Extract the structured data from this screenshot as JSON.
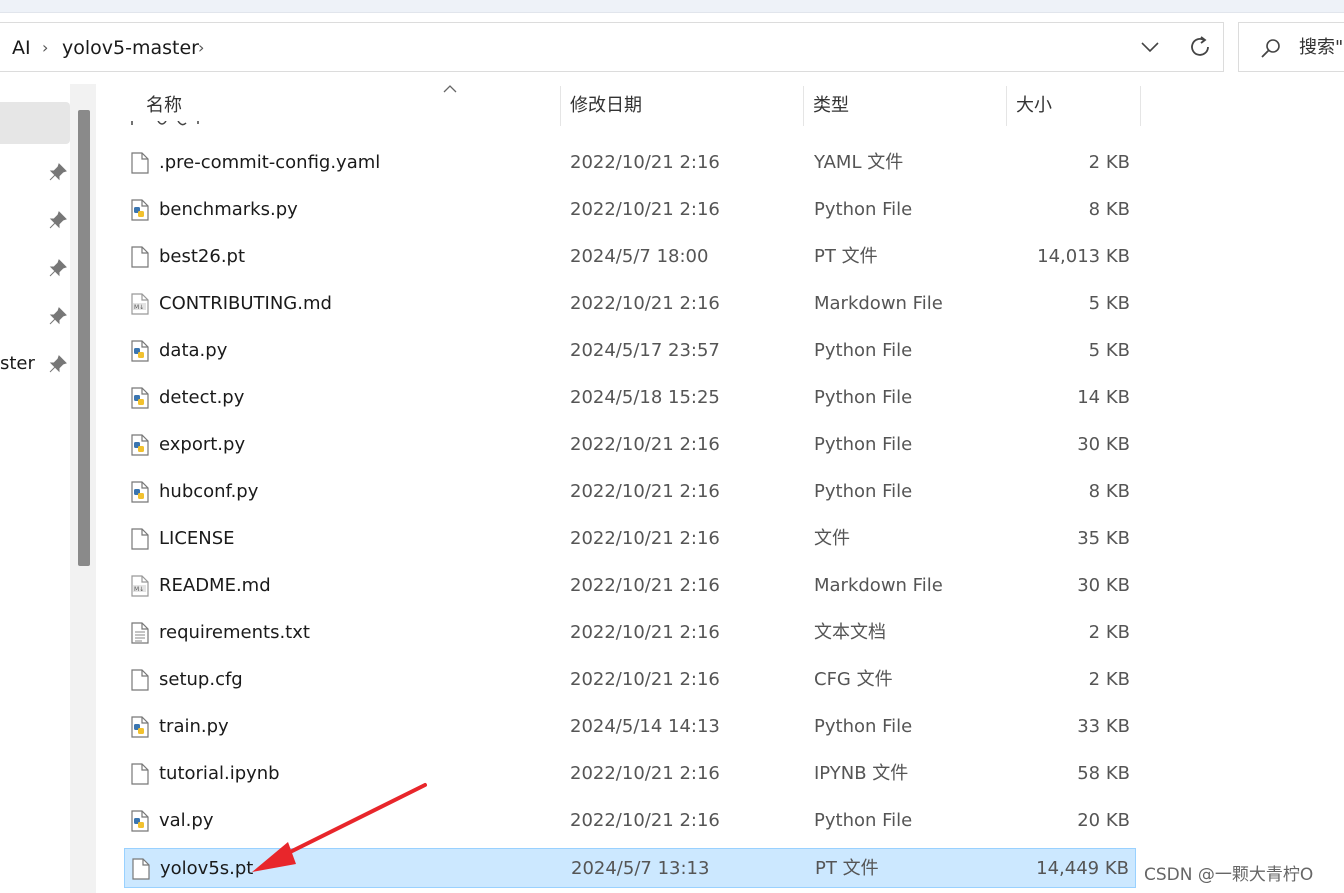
{
  "breadcrumb": {
    "items": [
      "AI",
      "yolov5-master"
    ]
  },
  "search": {
    "placeholder": "搜索\""
  },
  "sidebar": {
    "visible_label": "ster"
  },
  "columns": {
    "name": "名称",
    "date": "修改日期",
    "type": "类型",
    "size": "大小"
  },
  "files": [
    {
      "name": ".pre-commit-config.yaml",
      "date": "2022/10/21 2:16",
      "type": "YAML 文件",
      "size": "2 KB",
      "icon": "blank-file-icon"
    },
    {
      "name": "benchmarks.py",
      "date": "2022/10/21 2:16",
      "type": "Python File",
      "size": "8 KB",
      "icon": "python-file-icon"
    },
    {
      "name": "best26.pt",
      "date": "2024/5/7 18:00",
      "type": "PT 文件",
      "size": "14,013 KB",
      "icon": "blank-file-icon"
    },
    {
      "name": "CONTRIBUTING.md",
      "date": "2022/10/21 2:16",
      "type": "Markdown File",
      "size": "5 KB",
      "icon": "markdown-file-icon"
    },
    {
      "name": "data.py",
      "date": "2024/5/17 23:57",
      "type": "Python File",
      "size": "5 KB",
      "icon": "python-file-icon"
    },
    {
      "name": "detect.py",
      "date": "2024/5/18 15:25",
      "type": "Python File",
      "size": "14 KB",
      "icon": "python-file-icon"
    },
    {
      "name": "export.py",
      "date": "2022/10/21 2:16",
      "type": "Python File",
      "size": "30 KB",
      "icon": "python-file-icon"
    },
    {
      "name": "hubconf.py",
      "date": "2022/10/21 2:16",
      "type": "Python File",
      "size": "8 KB",
      "icon": "python-file-icon"
    },
    {
      "name": "LICENSE",
      "date": "2022/10/21 2:16",
      "type": "文件",
      "size": "35 KB",
      "icon": "blank-file-icon"
    },
    {
      "name": "README.md",
      "date": "2022/10/21 2:16",
      "type": "Markdown File",
      "size": "30 KB",
      "icon": "markdown-file-icon"
    },
    {
      "name": "requirements.txt",
      "date": "2022/10/21 2:16",
      "type": "文本文档",
      "size": "2 KB",
      "icon": "text-file-icon"
    },
    {
      "name": "setup.cfg",
      "date": "2022/10/21 2:16",
      "type": "CFG 文件",
      "size": "2 KB",
      "icon": "blank-file-icon"
    },
    {
      "name": "train.py",
      "date": "2024/5/14 14:13",
      "type": "Python File",
      "size": "33 KB",
      "icon": "python-file-icon"
    },
    {
      "name": "tutorial.ipynb",
      "date": "2022/10/21 2:16",
      "type": "IPYNB 文件",
      "size": "58 KB",
      "icon": "blank-file-icon"
    },
    {
      "name": "val.py",
      "date": "2022/10/21 2:16",
      "type": "Python File",
      "size": "20 KB",
      "icon": "python-file-icon"
    },
    {
      "name": "yolov5s.pt",
      "date": "2024/5/7 13:13",
      "type": "PT 文件",
      "size": "14,449 KB",
      "icon": "blank-file-icon",
      "selected": true
    }
  ],
  "watermark": "CSDN @一颗大青柠O",
  "colors": {
    "selection_bg": "#cce8ff",
    "selection_border": "#99d1ff",
    "arrow": "#e8262b"
  }
}
